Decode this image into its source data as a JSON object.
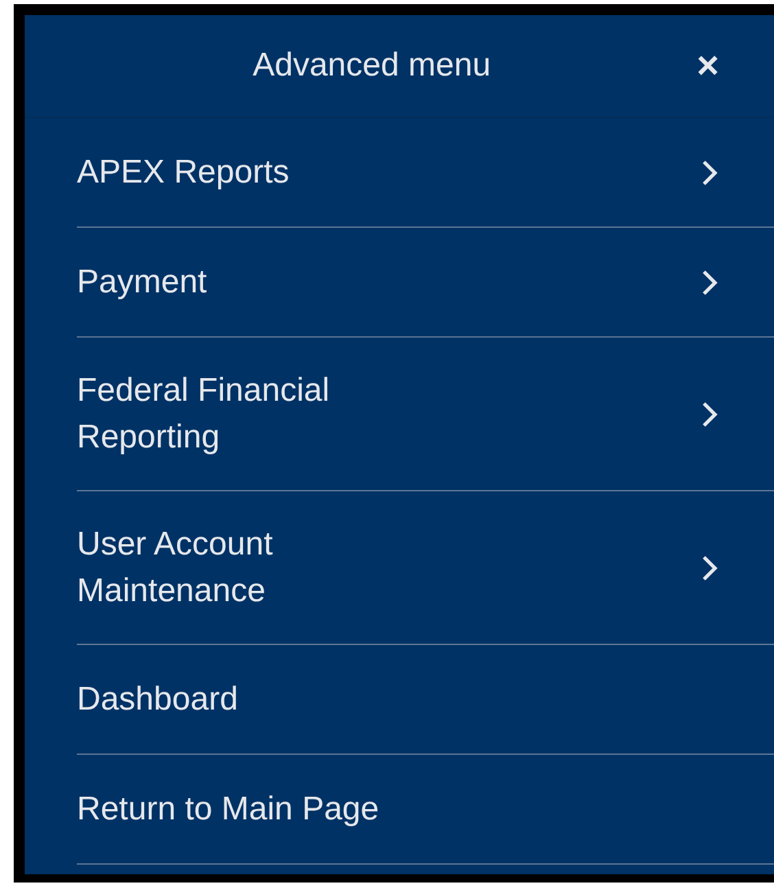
{
  "header": {
    "title": "Advanced menu",
    "close": "×"
  },
  "items": [
    {
      "label": "APEX Reports",
      "kind": "submenu"
    },
    {
      "label": "Payment",
      "kind": "submenu"
    },
    {
      "label": "Federal Financial Reporting",
      "kind": "submenu"
    },
    {
      "label": "User Account Maintenance",
      "kind": "submenu"
    },
    {
      "label": "Dashboard",
      "kind": "link"
    },
    {
      "label": "Return to Main Page",
      "kind": "link"
    }
  ]
}
